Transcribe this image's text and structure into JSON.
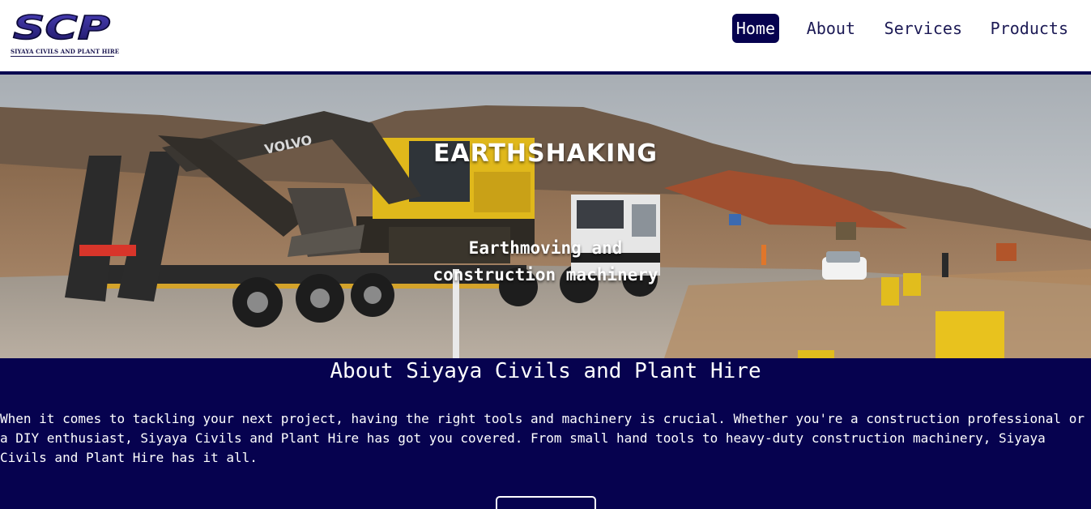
{
  "brand": {
    "logo_text": "SCP",
    "logo_subtitle": "SIYAYA CIVILS AND PLANT HIRE",
    "color": "#06024f"
  },
  "nav": {
    "items": [
      {
        "label": "Home",
        "active": true
      },
      {
        "label": "About",
        "active": false
      },
      {
        "label": "Services",
        "active": false
      },
      {
        "label": "Products",
        "active": false
      }
    ]
  },
  "hero": {
    "title": "EARTHSHAKING",
    "subtitle_line1": "Earthmoving and",
    "subtitle_line2": "construction machinery",
    "machine_brand": "VOLVO"
  },
  "about": {
    "title": "About Siyaya Civils and Plant Hire",
    "text": "When it comes to tackling your next project, having the right tools and machinery is crucial. Whether you're a construction professional or a DIY enthusiast, Siyaya Civils and Plant Hire has got you covered. From small hand tools to heavy-duty construction machinery, Siyaya Civils and Plant Hire has it all."
  },
  "colors": {
    "primary": "#06024f",
    "white": "#ffffff",
    "excavator_yellow": "#e8c21e"
  }
}
